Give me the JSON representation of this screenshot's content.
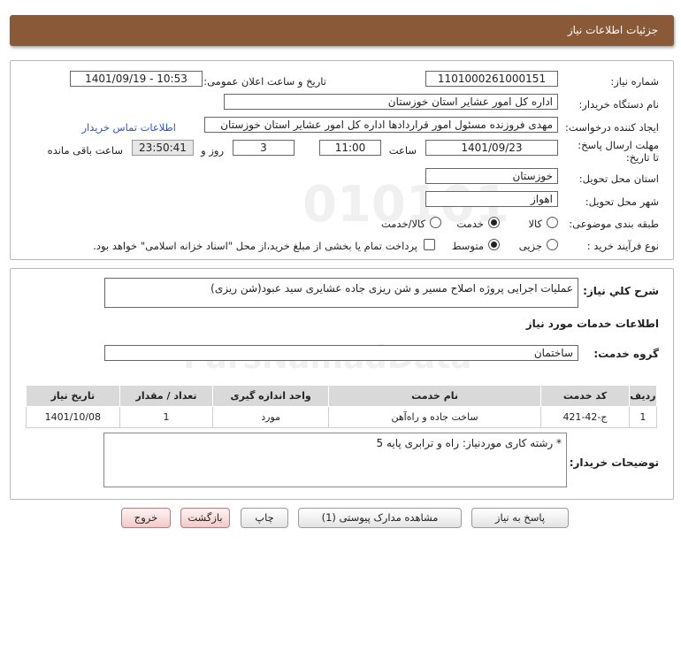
{
  "header": {
    "title": "جزئیات اطلاعات نیاز"
  },
  "details": {
    "need_number_label": "شماره نیاز:",
    "need_number": "1101000261000151",
    "announce_label": "تاریخ و ساعت اعلان عمومی:",
    "announce_value": "1401/09/19 - 10:53",
    "buyer_org_label": "نام دستگاه خریدار:",
    "buyer_org": "اداره کل امور عشایر استان خوزستان",
    "requester_label": "ایجاد کننده درخواست:",
    "requester": "مهدی فروزنده مسئول امور قراردادها اداره کل امور عشایر استان خوزستان",
    "contact_link": "اطلاعات تماس خریدار",
    "deadline_label": "مهلت ارسال پاسخ: تا تاریخ:",
    "deadline_date": "1401/09/23",
    "time_label": "ساعت",
    "deadline_time": "11:00",
    "days_value": "3",
    "days_label": "روز و",
    "remaining_time": "23:50:41",
    "remaining_label": "ساعت باقی مانده",
    "province_label": "استان محل تحویل:",
    "province": "خوزستان",
    "city_label": "شهر محل تحویل:",
    "city": "اهواز",
    "category_label": "طبقه بندی موضوعی:",
    "category_options": [
      "کالا",
      "خدمت",
      "کالا/خدمت"
    ],
    "process_label": "نوع فرآیند خرید :",
    "process_options": [
      "جزیی",
      "متوسط"
    ],
    "payment_note": "پرداخت تمام یا بخشی از مبلغ خرید،از محل \"اسناد خزانه اسلامی\" خواهد بود."
  },
  "summary": {
    "desc_label": "شرح کلي نیاز:",
    "desc_value": "عملیات اجرایی پروژه اصلاح مسیر و شن ریزی جاده عشایری سید عبود(شن ریزی)",
    "services_heading": "اطلاعات خدمات مورد نیاز",
    "group_label": "گروه خدمت:",
    "group_value": "ساختمان",
    "table": {
      "headers": [
        "ردیف",
        "کد خدمت",
        "نام خدمت",
        "واحد اندازه گیری",
        "تعداد / مقدار",
        "تاریخ نیاز"
      ],
      "rows": [
        [
          "1",
          "ج-42-421",
          "ساخت جاده و راه‌آهن",
          "مورد",
          "1",
          "1401/10/08"
        ]
      ]
    },
    "buyer_notes_label": "توضیحات خریدار:",
    "buyer_notes": "* رشته کاری موردنیاز:   راه و ترابری پایه 5"
  },
  "buttons": {
    "reply": "پاسخ به نیاز",
    "attachments": "مشاهده مدارک پیوستی (1)",
    "print": "چاپ",
    "back": "بازگشت",
    "exit": "خروج"
  },
  "colors": {
    "header_bg": "#8a5a38",
    "link": "#2f56c9"
  }
}
